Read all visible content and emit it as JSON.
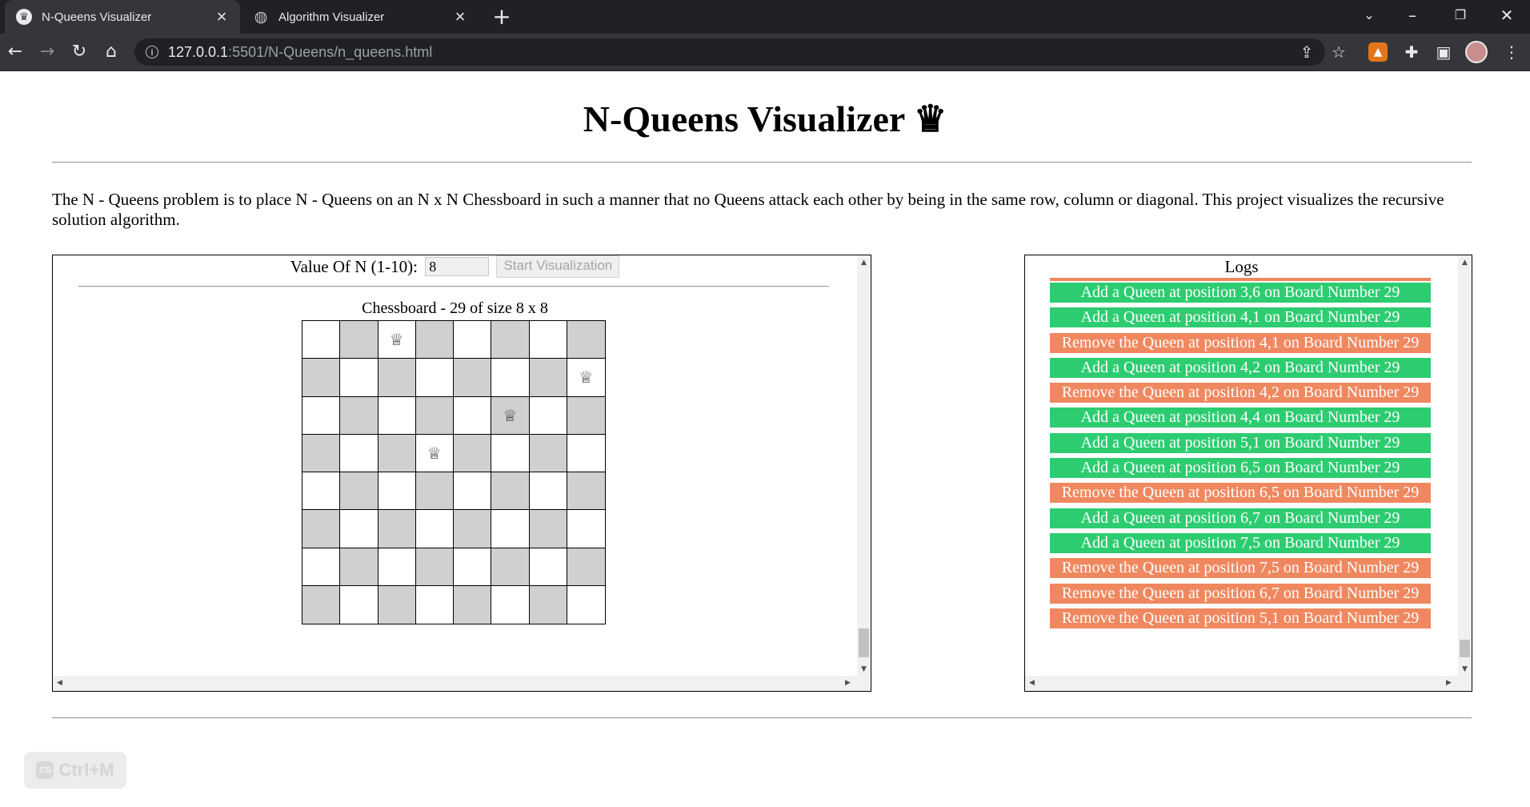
{
  "browser": {
    "tabs": [
      {
        "title": "N-Queens Visualizer",
        "icon": "crown-icon",
        "active": true
      },
      {
        "title": "Algorithm Visualizer",
        "icon": "globe-icon",
        "active": false
      }
    ],
    "url_host": "127.0.0.1",
    "url_path": ":5501/N-Queens/n_queens.html"
  },
  "page": {
    "title": "N-Queens Visualizer ♛",
    "description": "The N - Queens problem is to place N - Queens on an N x N Chessboard in such a manner that no Queens attack each other by being in the same row, column or diagonal. This project visualizes the recursive solution algorithm.",
    "n_label": "Value Of N (1-10):",
    "n_value": "8",
    "start_button": "Start Visualization",
    "board_title": "Chessboard - 29 of size 8 x 8",
    "board_size": 8,
    "queens": [
      [
        1,
        3
      ],
      [
        2,
        8
      ],
      [
        3,
        6
      ],
      [
        4,
        4
      ]
    ],
    "queen_glyph": "♕",
    "logs_title": "Logs",
    "logs": [
      {
        "type": "add",
        "text": "Add a Queen at position 3,6 on Board Number 29"
      },
      {
        "type": "add",
        "text": "Add a Queen at position 4,1 on Board Number 29"
      },
      {
        "type": "remove",
        "text": "Remove the Queen at position 4,1 on Board Number 29"
      },
      {
        "type": "add",
        "text": "Add a Queen at position 4,2 on Board Number 29"
      },
      {
        "type": "remove",
        "text": "Remove the Queen at position 4,2 on Board Number 29"
      },
      {
        "type": "add",
        "text": "Add a Queen at position 4,4 on Board Number 29"
      },
      {
        "type": "add",
        "text": "Add a Queen at position 5,1 on Board Number 29"
      },
      {
        "type": "add",
        "text": "Add a Queen at position 6,5 on Board Number 29"
      },
      {
        "type": "remove",
        "text": "Remove the Queen at position 6,5 on Board Number 29"
      },
      {
        "type": "add",
        "text": "Add a Queen at position 6,7 on Board Number 29"
      },
      {
        "type": "add",
        "text": "Add a Queen at position 7,5 on Board Number 29"
      },
      {
        "type": "remove",
        "text": "Remove the Queen at position 7,5 on Board Number 29"
      },
      {
        "type": "remove",
        "text": "Remove the Queen at position 6,7 on Board Number 29"
      },
      {
        "type": "remove",
        "text": "Remove the Queen at position 5,1 on Board Number 29"
      }
    ],
    "shortcut_label": "Ctrl+M",
    "shortcut_badge": "CS"
  },
  "colors": {
    "add": "#2ecc71",
    "remove": "#f0885f",
    "dark_square": "#d0d0d0"
  }
}
